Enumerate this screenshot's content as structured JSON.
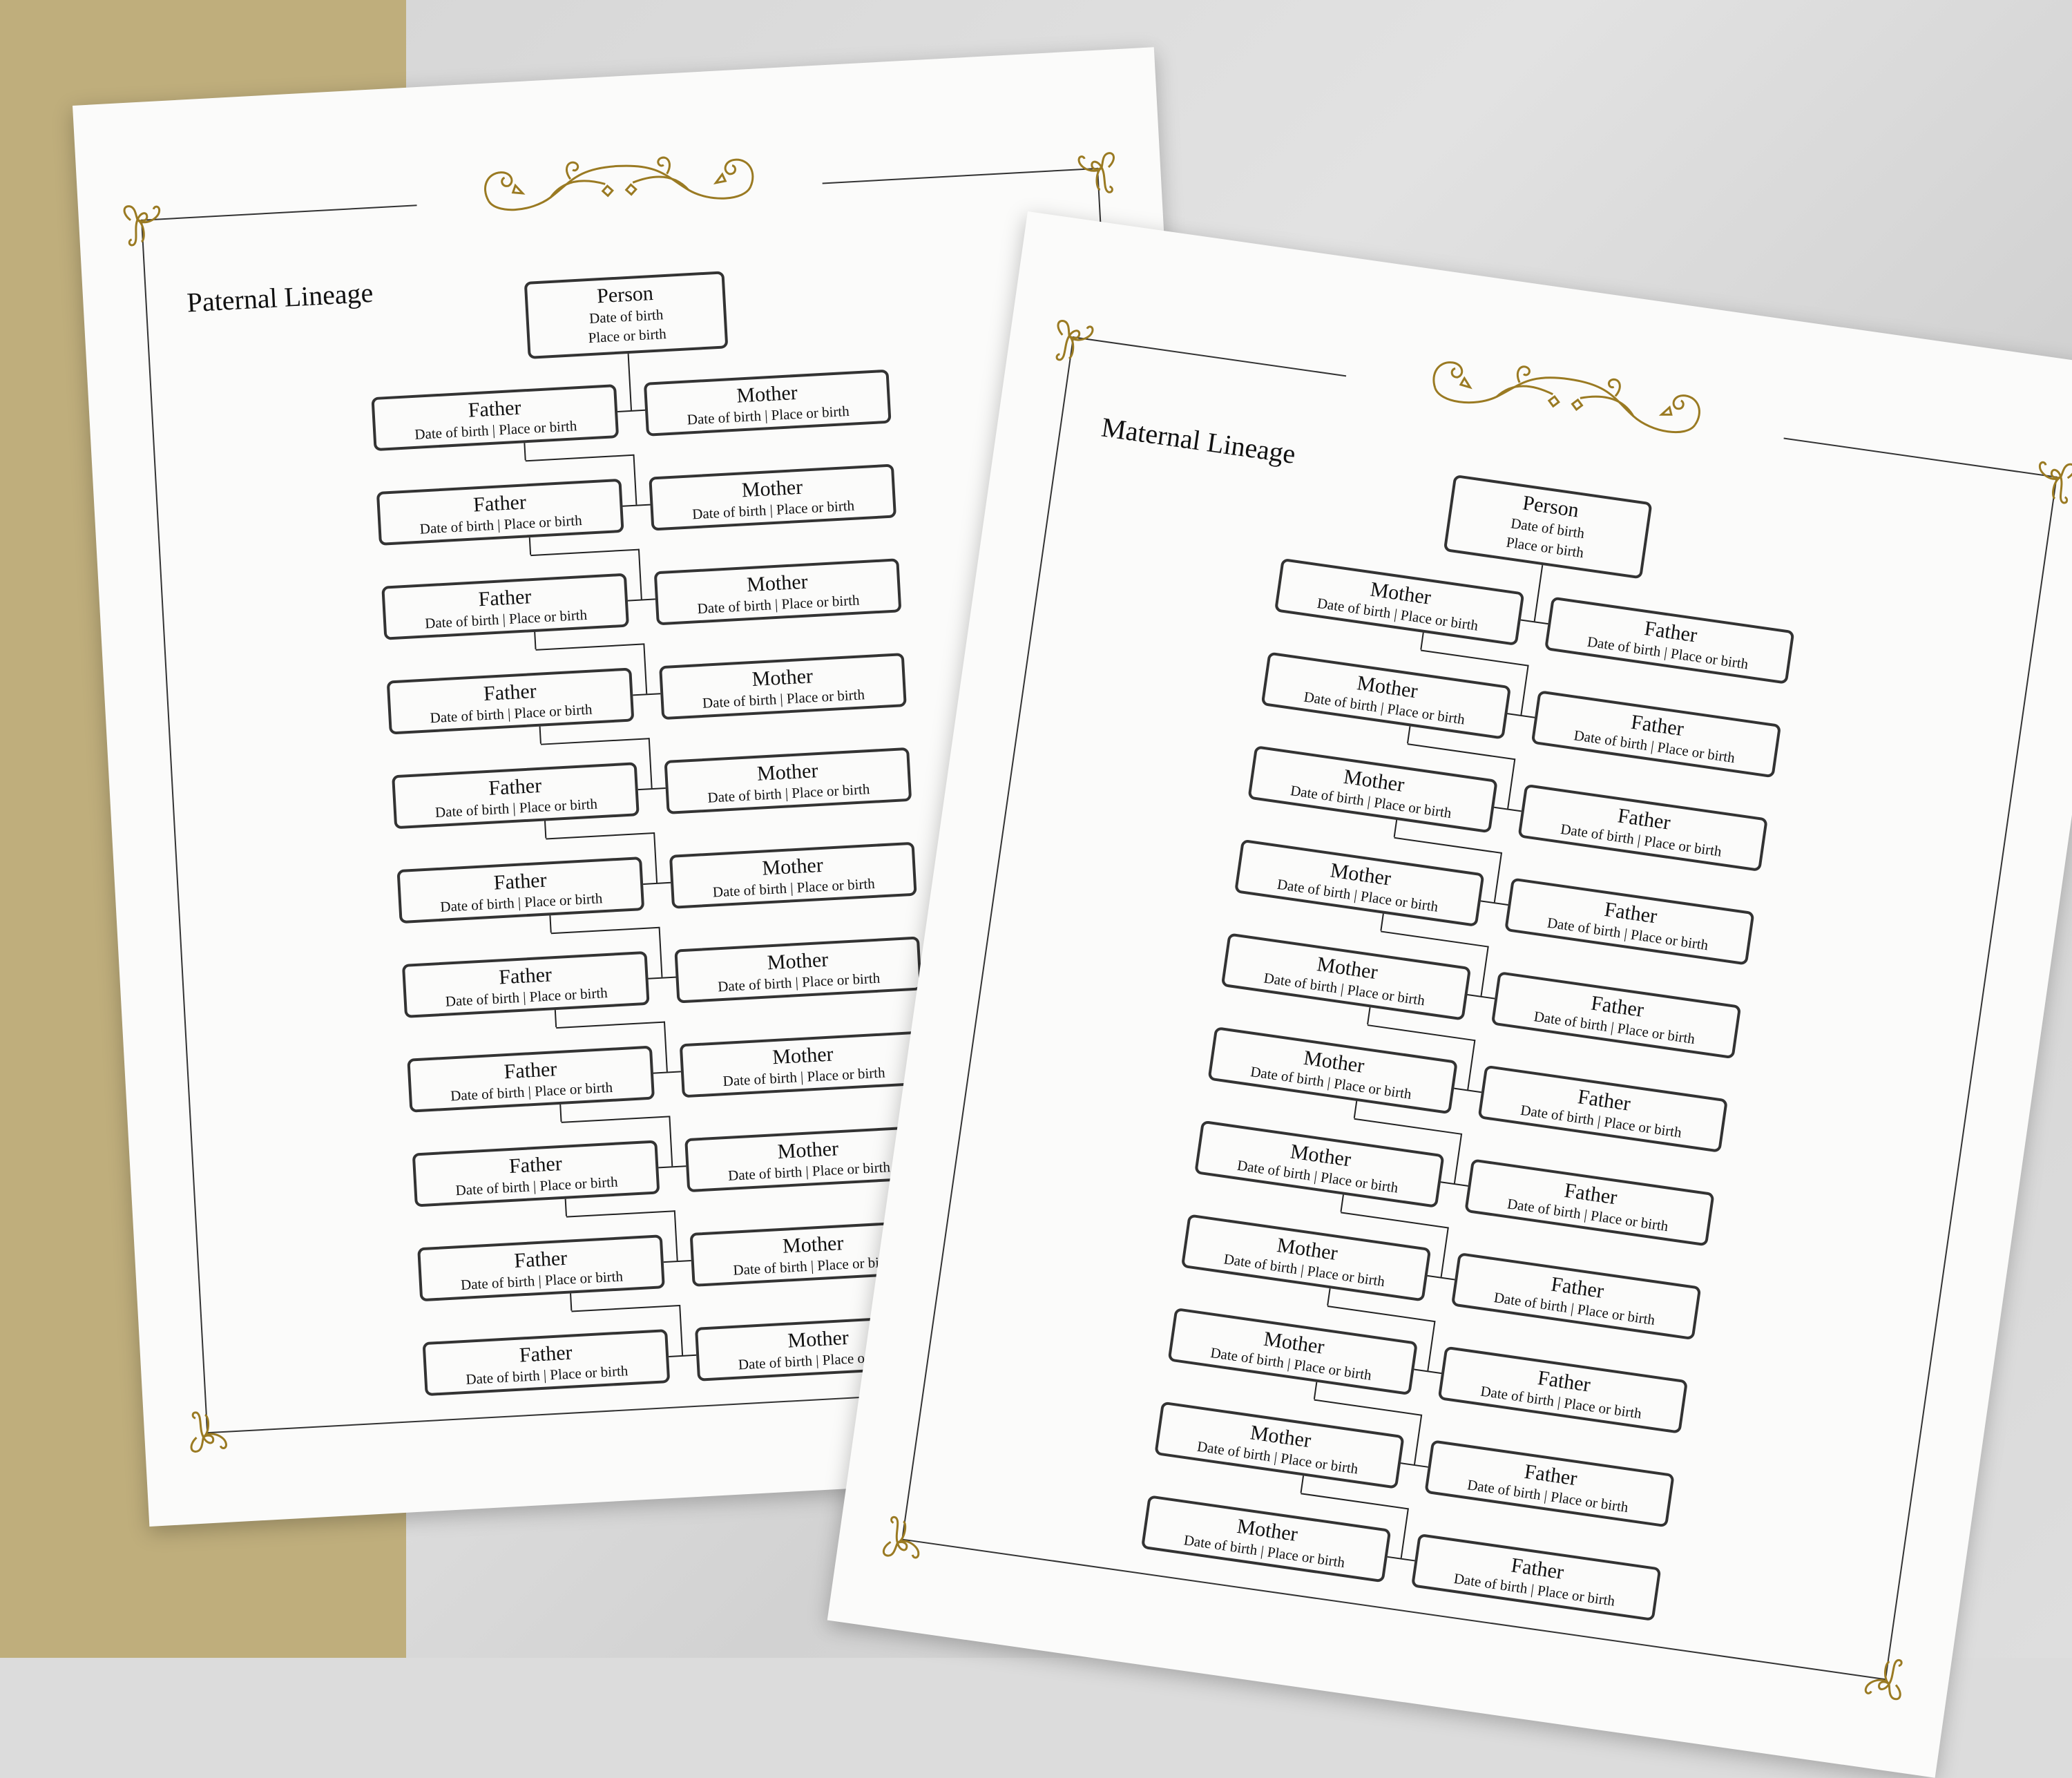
{
  "colors": {
    "gold": "#9a7a22",
    "ink": "#333333",
    "paper": "#fbfbfa",
    "backdrop_gold": "#bfae7c"
  },
  "pages": [
    {
      "title": "Paternal Lineage",
      "person": {
        "name": "Person",
        "line1": "Date of birth",
        "line2": "Place or birth"
      },
      "left_label": "Father",
      "right_label": "Mother",
      "detail": "Date of birth | Place or birth",
      "generations": 11
    },
    {
      "title": "Maternal Lineage",
      "person": {
        "name": "Person",
        "line1": "Date of birth",
        "line2": "Place or birth"
      },
      "left_label": "Mother",
      "right_label": "Father",
      "detail": "Date of birth | Place or birth",
      "generations": 11
    }
  ]
}
